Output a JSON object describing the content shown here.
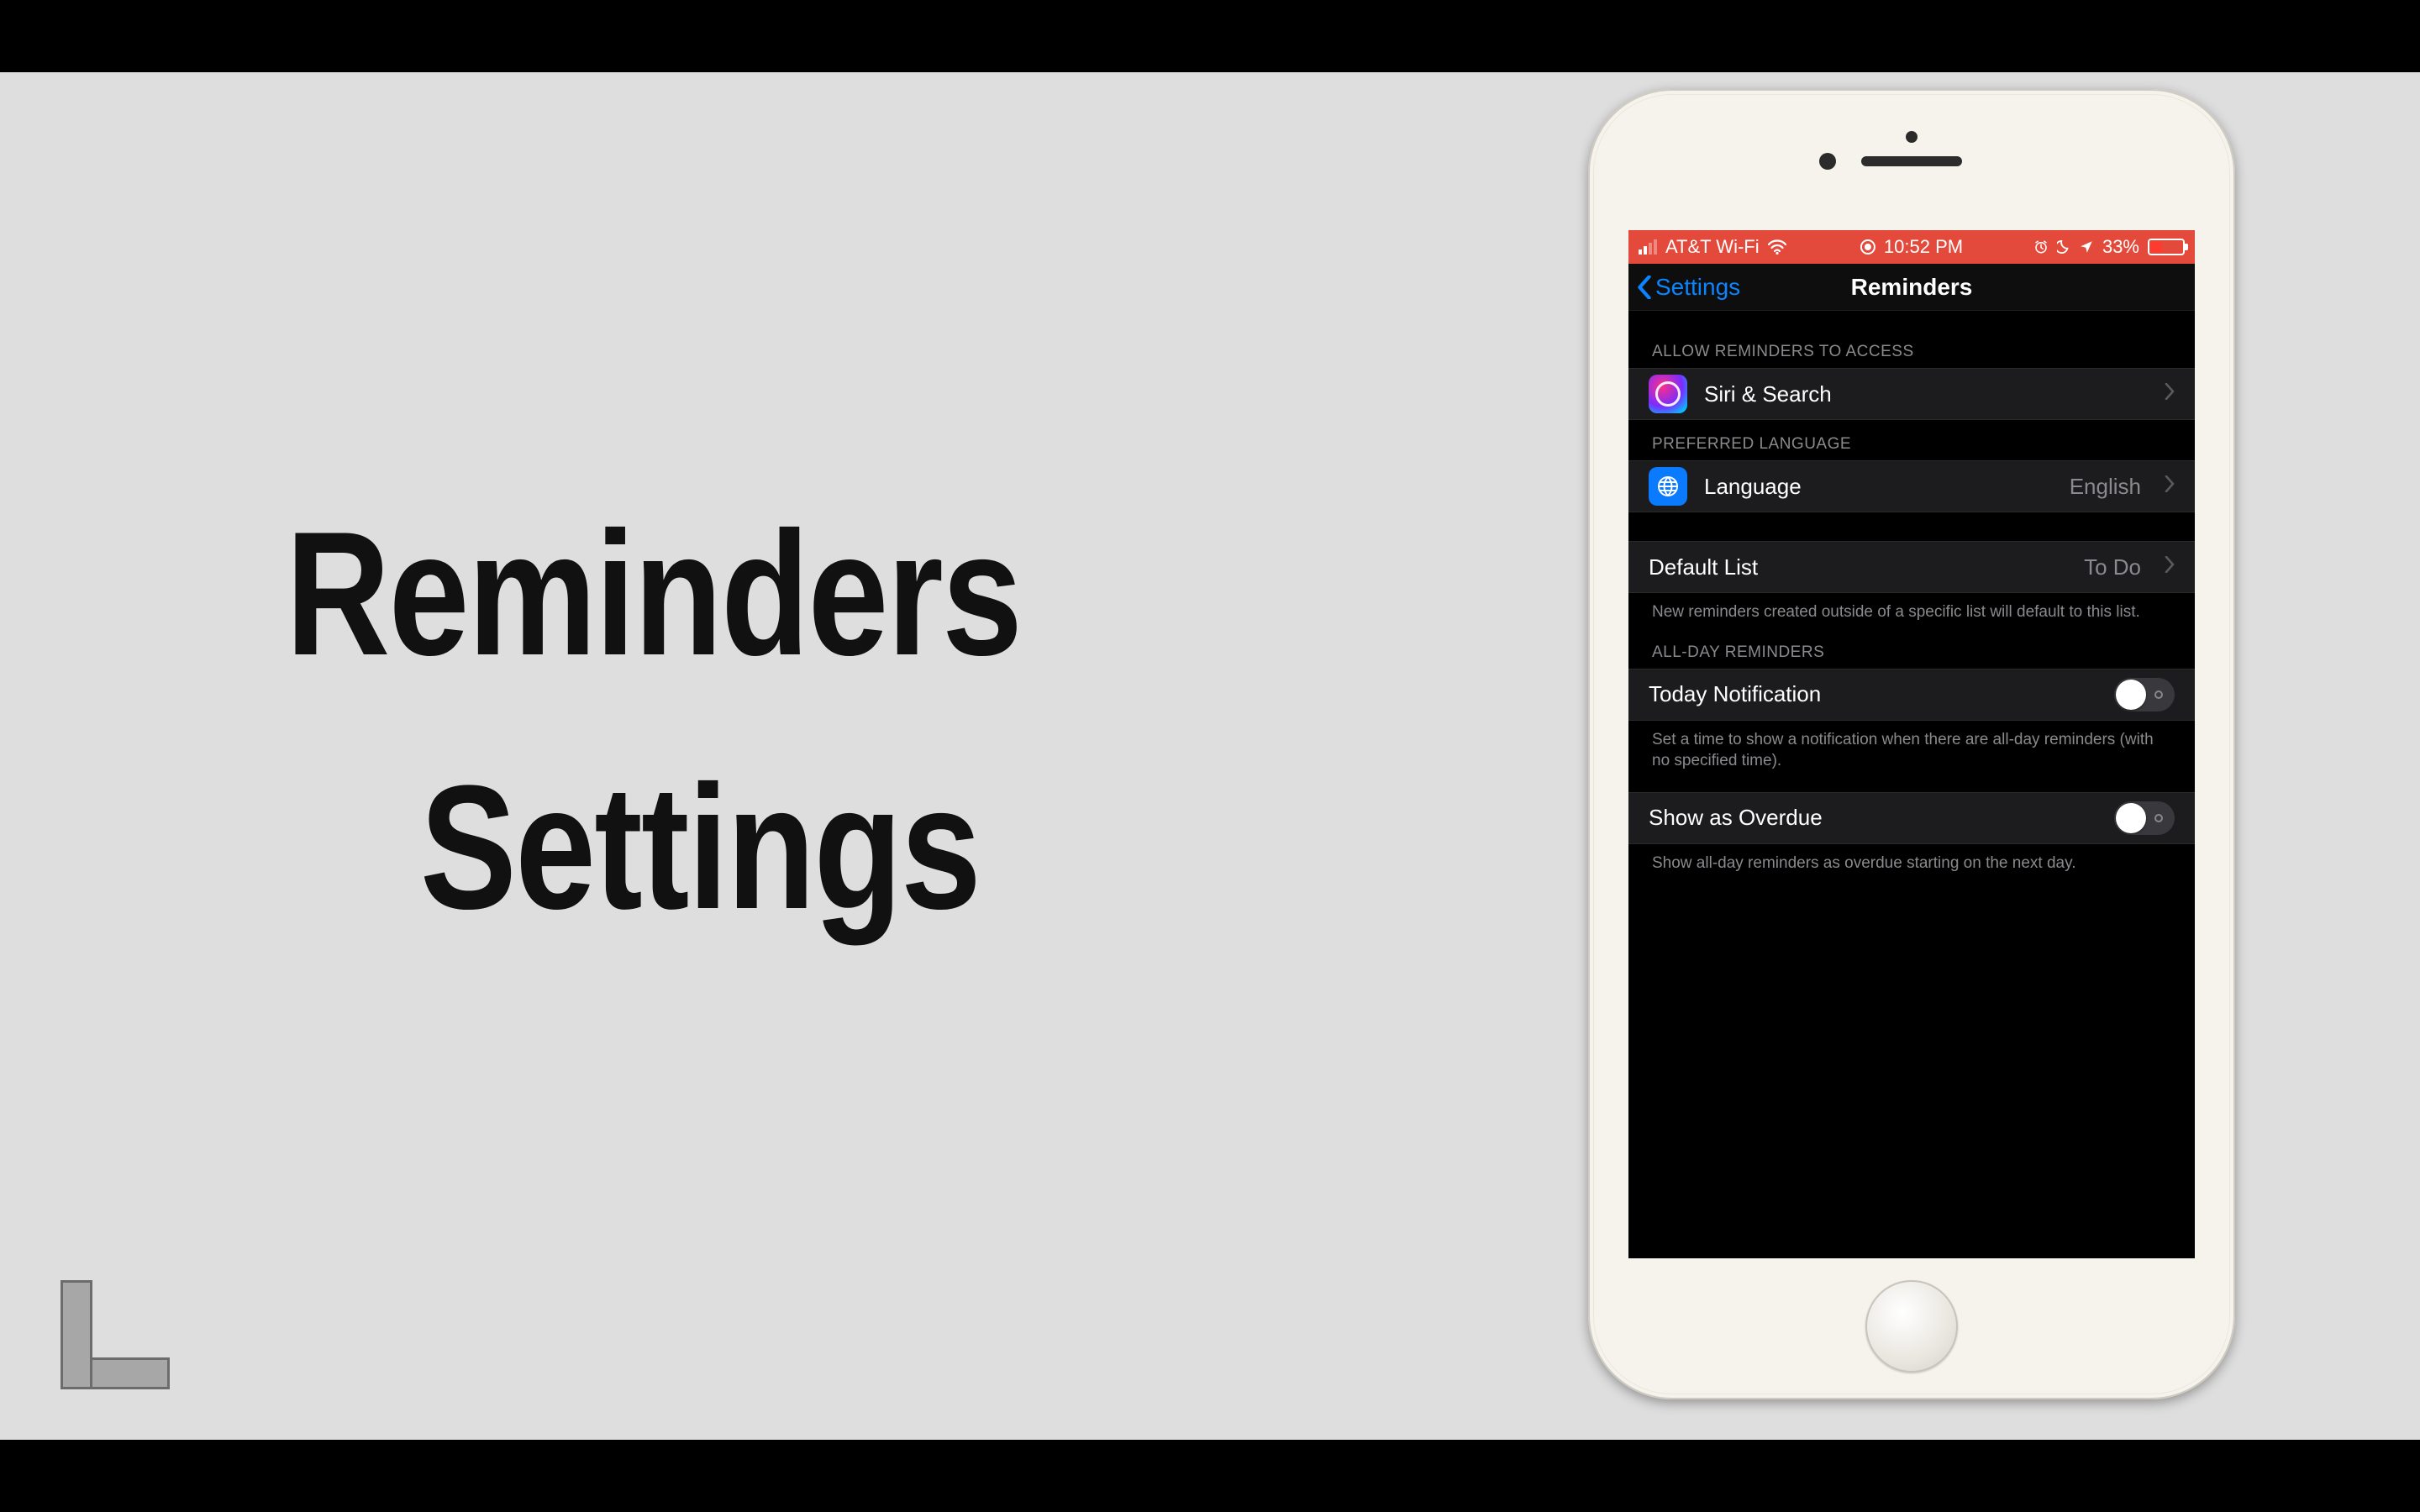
{
  "title": {
    "line1": "Reminders",
    "line2": "Settings"
  },
  "status": {
    "carrier": "AT&T Wi-Fi",
    "time": "10:52 PM",
    "battery_pct": "33%"
  },
  "nav": {
    "back": "Settings",
    "title": "Reminders"
  },
  "sections": {
    "access_header": "ALLOW REMINDERS TO ACCESS",
    "siri": "Siri & Search",
    "lang_header": "PREFERRED LANGUAGE",
    "language_label": "Language",
    "language_value": "English",
    "default_list_label": "Default List",
    "default_list_value": "To Do",
    "default_list_footer": "New reminders created outside of a specific list will default to this list.",
    "allday_header": "ALL-DAY REMINDERS",
    "today_notification": "Today Notification",
    "today_notification_footer": "Set a time to show a notification when there are all-day reminders (with no specified time).",
    "show_overdue": "Show as Overdue",
    "show_overdue_footer": "Show all-day reminders as overdue starting on the next day."
  },
  "toggles": {
    "today_notification": false,
    "show_overdue": false
  }
}
